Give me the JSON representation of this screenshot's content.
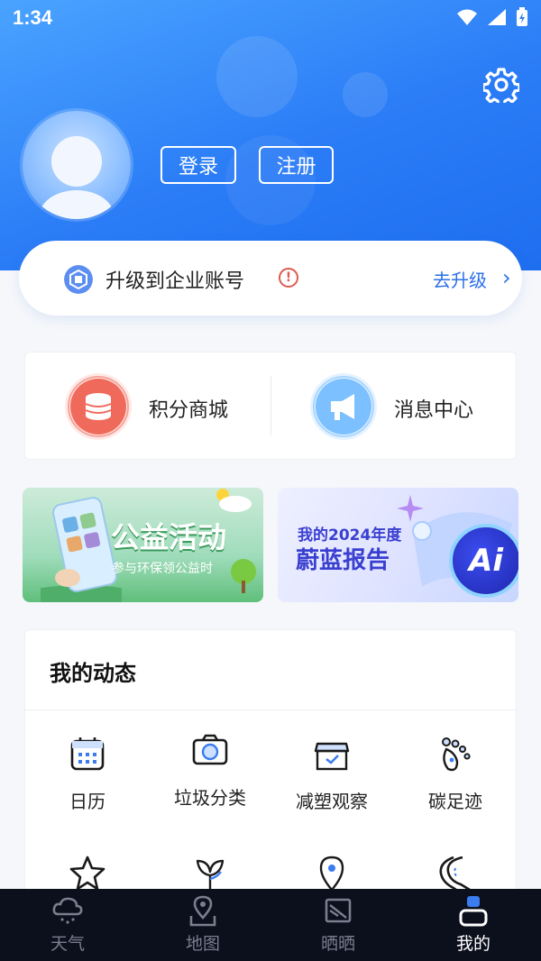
{
  "status_bar": {
    "time": "1:34"
  },
  "profile": {
    "login_label": "登录",
    "register_label": "注册"
  },
  "upgrade": {
    "label": "升级到企业账号",
    "warning": "!",
    "link": "去升级",
    "chevron": "›"
  },
  "quick_links": [
    {
      "label": "积分商城",
      "icon": "coin-stack-icon"
    },
    {
      "label": "消息中心",
      "icon": "megaphone-icon"
    }
  ],
  "banners": {
    "left": {
      "title": "公益活动",
      "subtitle": "参与环保领公益时"
    },
    "right": {
      "line1": "我的2024年度",
      "line2": "蔚蓝报告",
      "badge": "Ai"
    }
  },
  "feed": {
    "title": "我的动态",
    "items": [
      {
        "label": "日历",
        "icon": "calendar-icon"
      },
      {
        "label": "垃圾分类",
        "icon": "camera-icon"
      },
      {
        "label": "减塑观察",
        "icon": "shop-bag-icon"
      },
      {
        "label": "碳足迹",
        "icon": "footprint-icon"
      },
      {
        "label": "",
        "icon": "star-icon"
      },
      {
        "label": "",
        "icon": "leaf-icon"
      },
      {
        "label": "",
        "icon": "map-pin-icon"
      },
      {
        "label": "",
        "icon": "road-icon"
      }
    ]
  },
  "tabs": [
    {
      "label": "天气",
      "icon": "cloud-rain-icon",
      "active": false
    },
    {
      "label": "地图",
      "icon": "map-pin-icon",
      "active": false
    },
    {
      "label": "晒晒",
      "icon": "photo-icon",
      "active": false
    },
    {
      "label": "我的",
      "icon": "user-icon",
      "active": true
    }
  ],
  "colors": {
    "primary": "#2b7cf6",
    "link": "#2b6fe8",
    "warning": "#e05a4f",
    "tabbar": "#0c0f1c"
  }
}
